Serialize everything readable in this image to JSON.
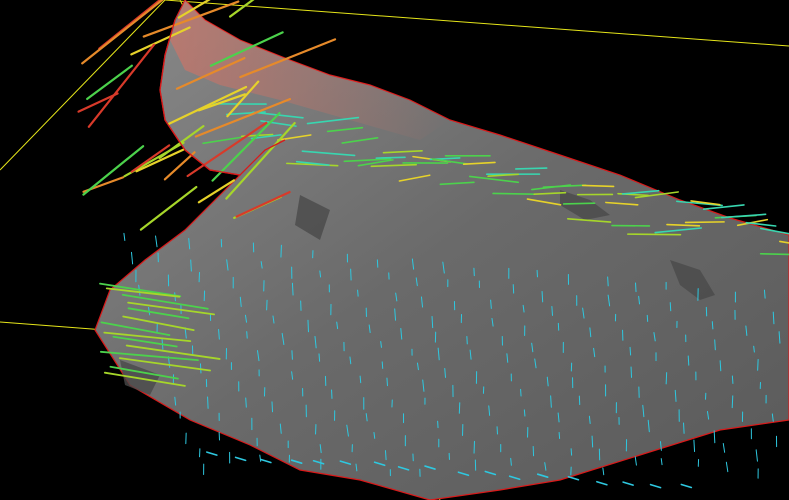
{
  "scene": {
    "background": "#000000",
    "surface_fill": "#6c6c6c",
    "surface_edge": "#d91a1a",
    "guide_line_color": "#e6e61a",
    "vector_palette": [
      "#2ec8e0",
      "#38d6b0",
      "#4cd24c",
      "#a6d62a",
      "#e6d22a",
      "#e68a2a",
      "#d83a2a"
    ]
  }
}
